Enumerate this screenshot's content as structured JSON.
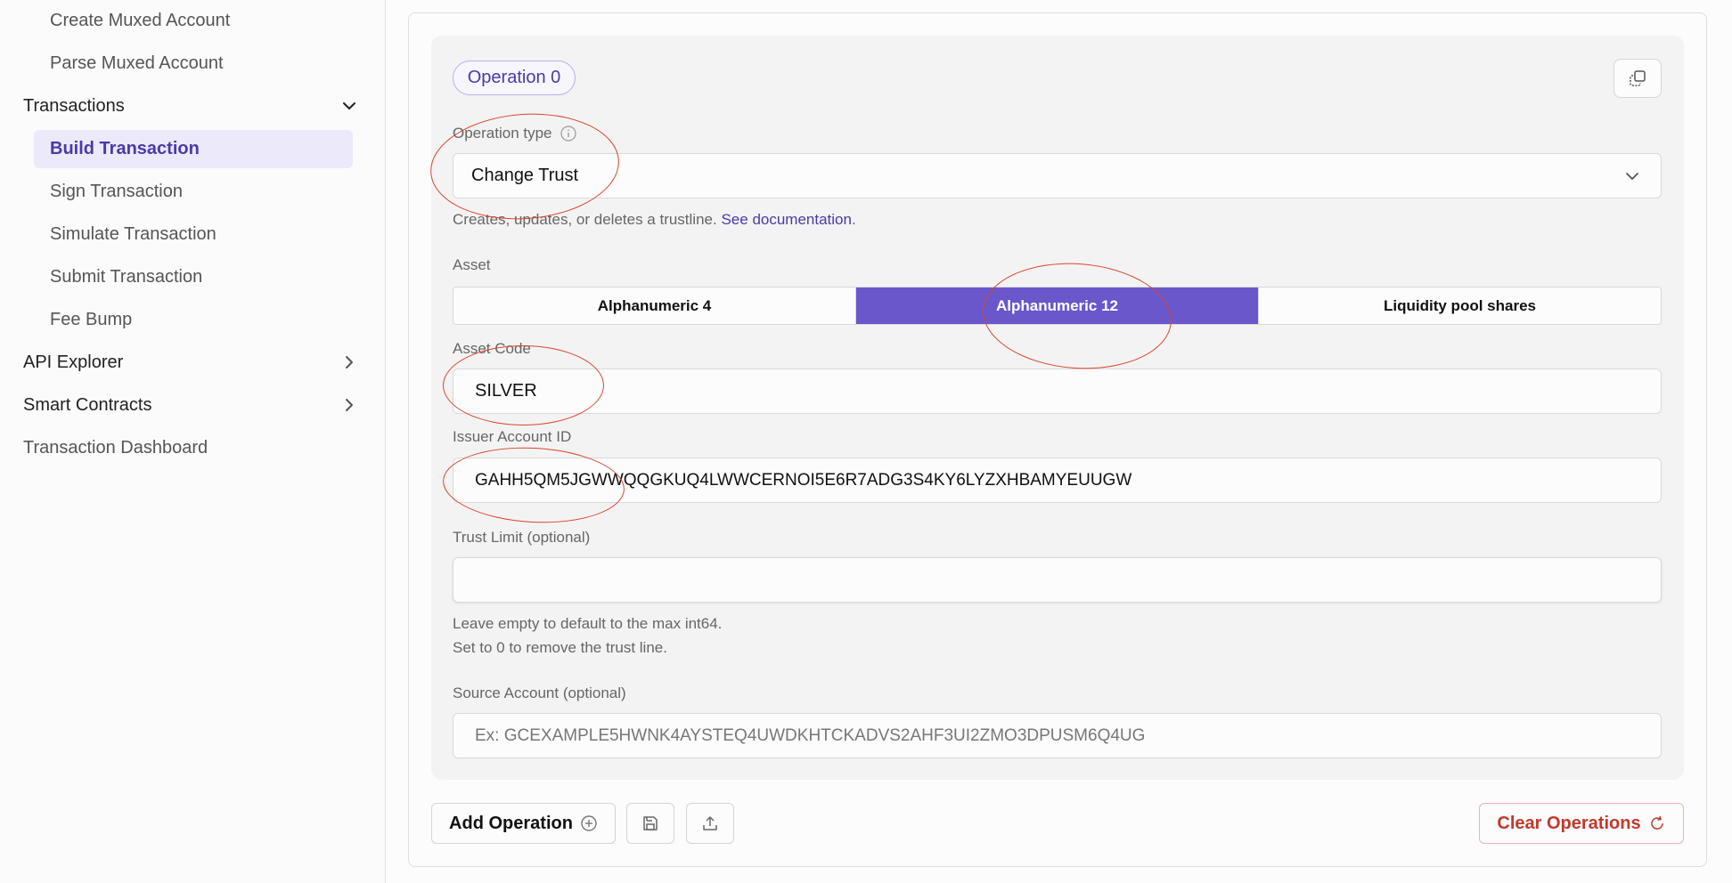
{
  "sidebar": {
    "items": [
      {
        "label": "Create Muxed Account"
      },
      {
        "label": "Parse Muxed Account"
      }
    ],
    "transactions_group": {
      "label": "Transactions",
      "icon": "chevron-down-icon"
    },
    "transactions_items": [
      {
        "label": "Build Transaction",
        "active": true
      },
      {
        "label": "Sign Transaction"
      },
      {
        "label": "Simulate Transaction"
      },
      {
        "label": "Submit Transaction"
      },
      {
        "label": "Fee Bump"
      }
    ],
    "api_explorer": {
      "label": "API Explorer",
      "icon": "chevron-right-icon"
    },
    "smart_contracts": {
      "label": "Smart Contracts",
      "icon": "chevron-right-icon"
    },
    "dashboard": {
      "label": "Transaction Dashboard"
    }
  },
  "operation": {
    "badge": "Operation 0",
    "type_label": "Operation type",
    "type_value": "Change Trust",
    "type_help": "Creates, updates, or deletes a trustline.",
    "doc_link": "See documentation",
    "doc_suffix": ".",
    "asset_label": "Asset",
    "asset_tabs": [
      {
        "label": "Alphanumeric 4",
        "active": false
      },
      {
        "label": "Alphanumeric 12",
        "active": true
      },
      {
        "label": "Liquidity pool shares",
        "active": false
      }
    ],
    "asset_code_label": "Asset Code",
    "asset_code_value": "SILVER",
    "issuer_label": "Issuer Account ID",
    "issuer_value": "GAHH5QM5JGWWQQGKUQ4LWWCERNOI5E6R7ADG3S4KY6LYZXHBAMYEUUGW",
    "trust_limit_label": "Trust Limit",
    "trust_limit_optional": "(optional)",
    "trust_limit_value": "",
    "trust_help_1": "Leave empty to default to the max int64.",
    "trust_help_2": "Set to 0 to remove the trust line.",
    "source_label": "Source Account",
    "source_optional": "(optional)",
    "source_placeholder": "Ex: GCEXAMPLE5HWNK4AYSTEQ4UWDKHTCKADVS2AHF3UI2ZMO3DPUSM6Q4UG"
  },
  "actions": {
    "add_operation": "Add Operation",
    "clear_operations": "Clear Operations"
  },
  "colors": {
    "accent": "#6a57cb",
    "accent_text": "#4b3aa8",
    "danger": "#c0392b",
    "annotation": "#d84530"
  }
}
